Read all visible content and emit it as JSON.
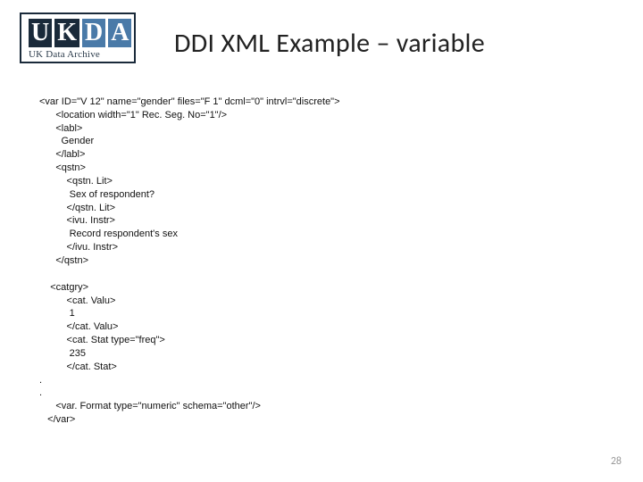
{
  "logo": {
    "u": "U",
    "k": "K",
    "d": "D",
    "a": "A",
    "sub": "UK Data Archive"
  },
  "title": "DDI XML Example – variable",
  "xml": {
    "l1": "<var ID=\"V 12\" name=\"gender\" files=\"F 1\" dcml=\"0\" intrvl=\"discrete\">",
    "l2": "      <location width=\"1\" Rec. Seg. No=\"1\"/>",
    "l3": "      <labl>",
    "l4": "        Gender",
    "l5": "      </labl>",
    "l6": "      <qstn>",
    "l7": "          <qstn. Lit>",
    "l8": "           Sex of respondent?",
    "l9": "          </qstn. Lit>",
    "l10": "          <ivu. Instr>",
    "l11": "           Record respondent's sex",
    "l12": "          </ivu. Instr>",
    "l13": "      </qstn>",
    "l14": "",
    "l15": "    <catgry>",
    "l16": "          <cat. Valu>",
    "l17": "           1",
    "l18": "          </cat. Valu>",
    "l19": "          <cat. Stat type=\"freq\">",
    "l20": "           235",
    "l21": "          </cat. Stat>",
    "l22": ".",
    "l23": ".",
    "l24": "      <var. Format type=\"numeric\" schema=\"other\"/>",
    "l25": "   </var>"
  },
  "page_number": "28"
}
